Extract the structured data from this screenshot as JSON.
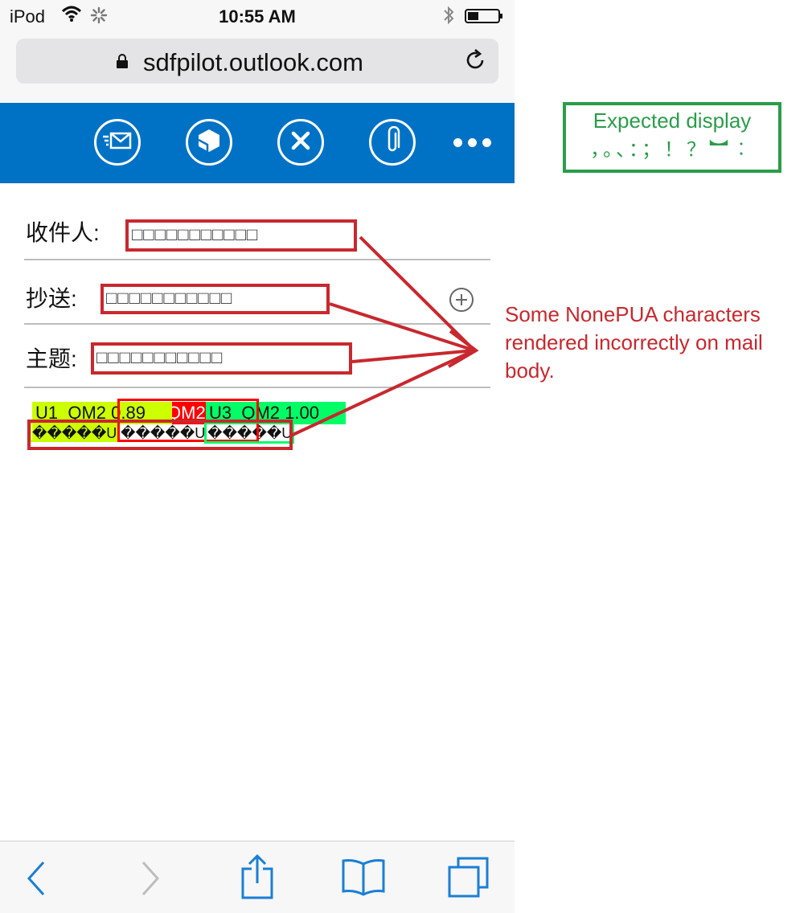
{
  "status_bar": {
    "carrier": "iPod",
    "time": "10:55 AM"
  },
  "browser": {
    "url": "sdfpilot.outlook.com"
  },
  "toolbar": {
    "icons": [
      "send-icon",
      "cube-icon",
      "close-icon",
      "attach-icon",
      "more-icon"
    ]
  },
  "compose": {
    "to_label": "收件人:",
    "to_value": "□□□□□□□□□□□",
    "cc_label": "抄送:",
    "cc_value": "□□□□□□□□□□□",
    "subject_label": "主题:",
    "subject_value": "□□□□□□□□□□□"
  },
  "body": {
    "cells": [
      "U1_QM2 0.89",
      "QM2",
      "U3_QM2 1.00"
    ],
    "raw_line_1": "�����U1",
    "raw_line_2": "�����U2",
    "raw_line_3": "�����U3"
  },
  "annotations": {
    "expected_title": "Expected display",
    "expected_chars": "，。、：；！？︼︰",
    "note": "Some NonePUA characters rendered incorrectly on mail body."
  },
  "colors": {
    "toolbar_blue": "#0072c6",
    "annotation_red": "#c8282e",
    "annotation_green": "#2a9d4a",
    "cell_yellow": "#ccff00",
    "cell_red": "#ff0000",
    "cell_green": "#00ff66"
  }
}
